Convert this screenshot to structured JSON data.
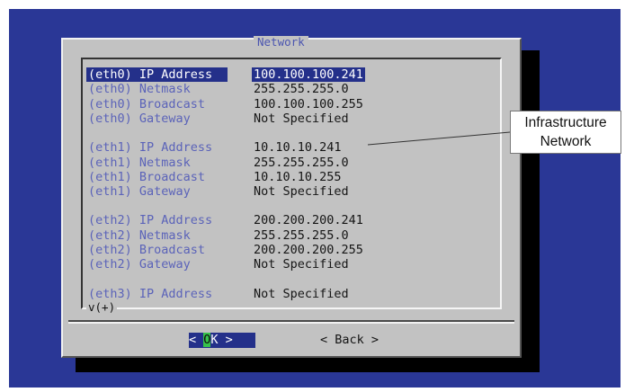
{
  "dialog": {
    "title": "Network"
  },
  "network_rows": [
    {
      "label": "(eth0) IP Address",
      "value": "100.100.100.241",
      "selected": true
    },
    {
      "label": "(eth0) Netmask",
      "value": "255.255.255.0"
    },
    {
      "label": "(eth0) Broadcast",
      "value": "100.100.100.255"
    },
    {
      "label": "(eth0) Gateway",
      "value": "Not Specified"
    },
    {
      "label": "(eth1) IP Address",
      "value": "10.10.10.241"
    },
    {
      "label": "(eth1) Netmask",
      "value": "255.255.255.0"
    },
    {
      "label": "(eth1) Broadcast",
      "value": "10.10.10.255"
    },
    {
      "label": "(eth1) Gateway",
      "value": "Not Specified"
    },
    {
      "label": "(eth2) IP Address",
      "value": "200.200.200.241"
    },
    {
      "label": "(eth2) Netmask",
      "value": "255.255.255.0"
    },
    {
      "label": "(eth2) Broadcast",
      "value": "200.200.200.255"
    },
    {
      "label": "(eth2) Gateway",
      "value": "Not Specified"
    },
    {
      "label": "(eth3) IP Address",
      "value": "Not Specified"
    }
  ],
  "more_indicator": "v(+)",
  "buttons": {
    "ok": {
      "left": "< ",
      "hotkey": "O",
      "rest": "K >"
    },
    "back": "< Back >"
  },
  "callout": {
    "line1": "Infrastructure",
    "line2": "Network"
  },
  "colors": {
    "screen_bg": "#2a3796",
    "dialog_bg": "#c2c2c2",
    "selection_bg": "#24308a",
    "label_text": "#5b63b9",
    "hotkey_bg": "#37c24a"
  }
}
